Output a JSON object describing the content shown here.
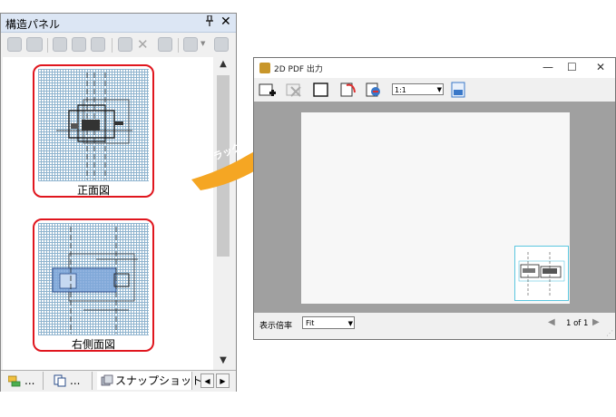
{
  "left_panel": {
    "title": "構造パネル",
    "pin_icon": "pin-icon",
    "close_label": "✕",
    "toolbar_icons": [
      "snapshot-add-icon",
      "new-window-icon",
      "view-icon",
      "structure-icon",
      "filter-icon",
      "render-icon",
      "delete-icon",
      "properties-icon",
      "layout-icon",
      "list-icon"
    ],
    "items": [
      {
        "caption": "正面図",
        "selected": true
      },
      {
        "caption": "右側面図",
        "selected": true
      }
    ],
    "scroll_up_label": "▲",
    "scroll_down_label": "▼",
    "tabs": [
      {
        "label": "...",
        "icon": "folder-tree-icon"
      },
      {
        "label": "...",
        "icon": "pages-icon"
      },
      {
        "label": "スナップショット",
        "icon": "snapshot-icon",
        "active": true
      }
    ],
    "nav_prev": "◀",
    "nav_next": "▶"
  },
  "annotation": {
    "label": "ドラッグアンドドロップ",
    "color": "#f5a623"
  },
  "pdf_window": {
    "title": "2D PDF 出力",
    "minimize_label": "—",
    "maximize_label": "☐",
    "close_label": "✕",
    "toolbar_icons": [
      "add-page-icon",
      "delete-page-icon",
      "frame-icon",
      "rotate-icon",
      "refresh-icon",
      "export-pdf-icon"
    ],
    "zoom_value": "1:1",
    "status": {
      "zoom_label": "表示倍率",
      "fit_value": "Fit",
      "page_info": "1 of 1",
      "prev_label": "◀",
      "next_label": "▶"
    }
  },
  "colors": {
    "selection_border": "#e0161e",
    "view_background": "#a0a0a0",
    "panel_title_bg": "#dce6f4"
  }
}
